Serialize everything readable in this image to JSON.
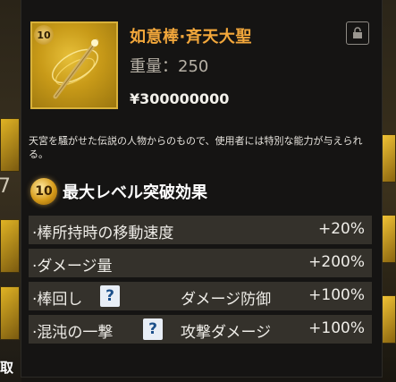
{
  "item": {
    "level": "10",
    "name": "如意棒·斉天大聖",
    "weight": "重量：250",
    "price": "¥300000000",
    "description": "天宮を騒がせた伝説の人物からのもので、使用者には特別な能力が与えられる。"
  },
  "limit_break": {
    "level": "10",
    "title": "最大レベル突破効果",
    "rows": [
      {
        "label": "·棒所持時の移動速度",
        "sub": "",
        "value": "+20%"
      },
      {
        "label": "·ダメージ量",
        "sub": "",
        "value": "+200%"
      },
      {
        "label": "·棒回し",
        "help": "?",
        "sub": "ダメージ防御",
        "value": "+100%"
      },
      {
        "label": "·混沌の一撃",
        "help": "?",
        "sub": "攻撃ダメージ",
        "value": "+100%"
      }
    ]
  },
  "background": {
    "left_number": "7",
    "left_text": "取"
  },
  "icons": {
    "lock": "lock-icon",
    "help": "question-icon",
    "item": "golden-staff-icon",
    "badge": "level-badge-icon"
  },
  "colors": {
    "item_name": "#f2a73b",
    "badge_gold": "#d69b1a",
    "row_bg": "#34312b",
    "help_blue": "#1b4f8a"
  }
}
